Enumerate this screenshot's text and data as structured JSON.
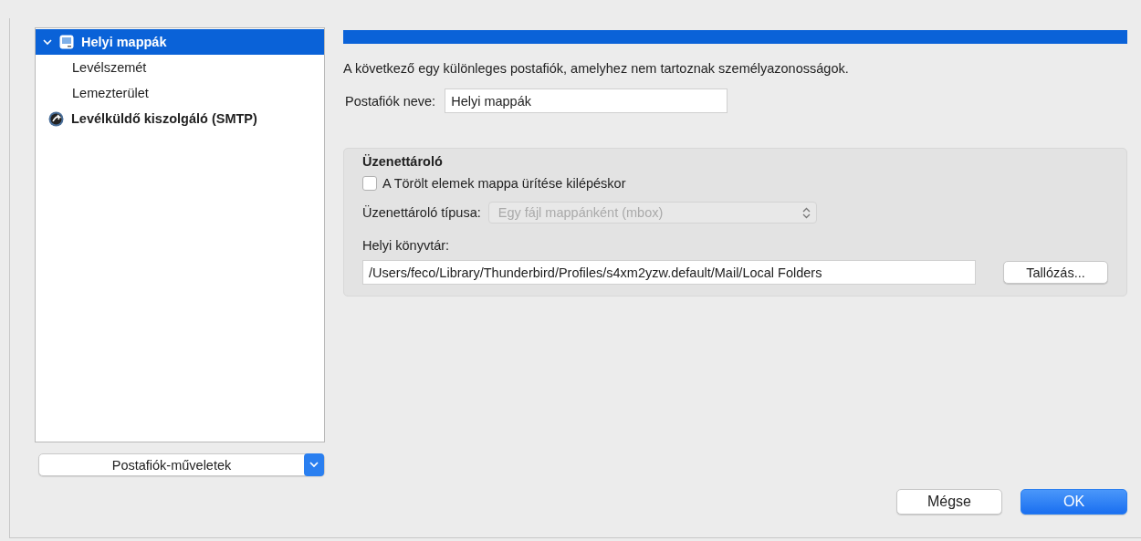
{
  "sidebar": {
    "items": [
      {
        "label": "Helyi mappák",
        "kind": "account",
        "selected": true,
        "expanded": true,
        "children": [
          {
            "label": "Levélszemét",
            "kind": "folder",
            "selected": false
          },
          {
            "label": "Lemezterület",
            "kind": "folder",
            "selected": false
          }
        ]
      },
      {
        "label": "Levélküldő kiszolgáló (SMTP)",
        "kind": "smtp",
        "selected": false
      }
    ],
    "actions_menu": "Postafiók-műveletek"
  },
  "description": "A következő egy különleges postafiók, amelyhez nem tartoznak személyazonosságok.",
  "account_name": {
    "label": "Postafiók neve:",
    "value": "Helyi mappák"
  },
  "message_store": {
    "title": "Üzenettároló",
    "empty_trash": {
      "label": "A Törölt elemek mappa ürítése kilépéskor",
      "checked": false
    },
    "store_type": {
      "label": "Üzenettároló típusa:",
      "value": "Egy fájl mappánként (mbox)",
      "disabled": true
    },
    "local_directory": {
      "label": "Helyi könyvtár:",
      "value": "/Users/feco/Library/Thunderbird/Profiles/s4xm2yzw.default/Mail/Local Folders",
      "browse": "Tallózás..."
    }
  },
  "buttons": [
    {
      "label": "Mégse",
      "kind": "cancel"
    },
    {
      "label": "OK",
      "kind": "default"
    }
  ]
}
